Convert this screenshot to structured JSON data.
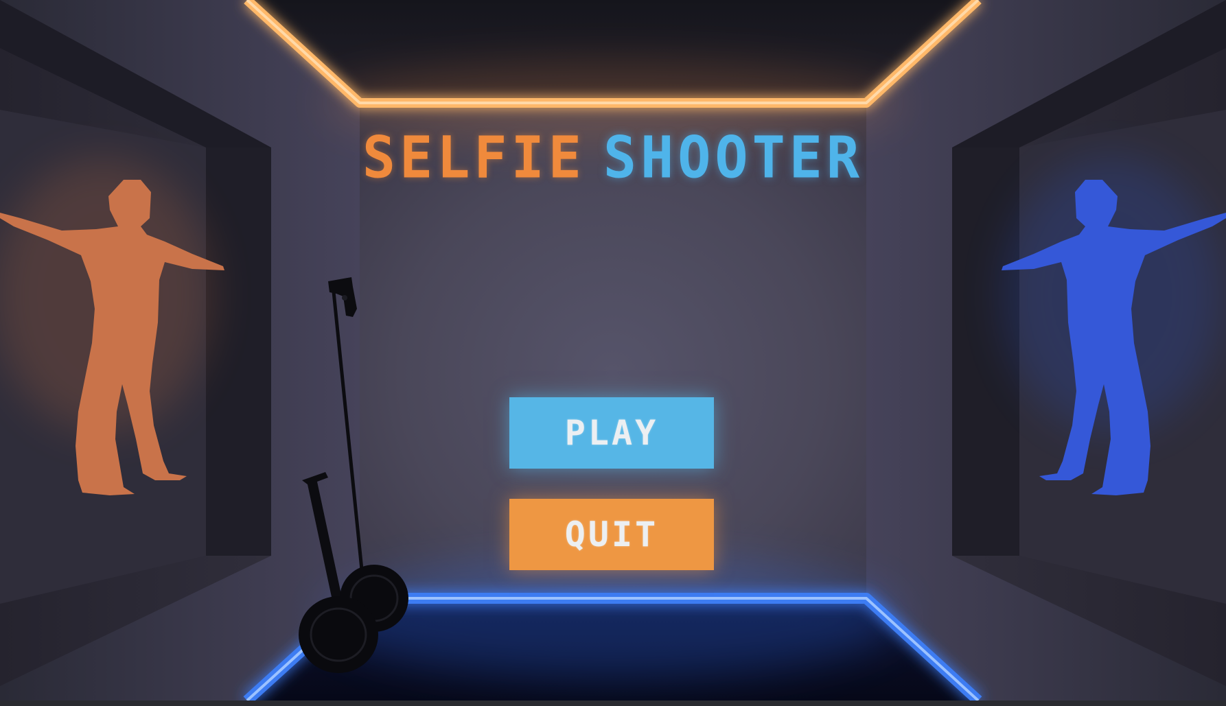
{
  "title": {
    "part1": "SELFIE",
    "part2": "SHOOTER",
    "part1_color": "#f08a3c",
    "part2_color": "#4fb4ea"
  },
  "menu": {
    "play_label": "PLAY",
    "quit_label": "QUIT",
    "play_color": "#56b6e6",
    "quit_color": "#ee9743"
  },
  "scene": {
    "neon_top_color": "#f59a45",
    "neon_bottom_color": "#3f7cf0",
    "left_figure_color": "#c9734a",
    "right_figure_color": "#3558d8",
    "left_object": "pistol-on-stick-icon",
    "right_object": "segway-icon"
  }
}
